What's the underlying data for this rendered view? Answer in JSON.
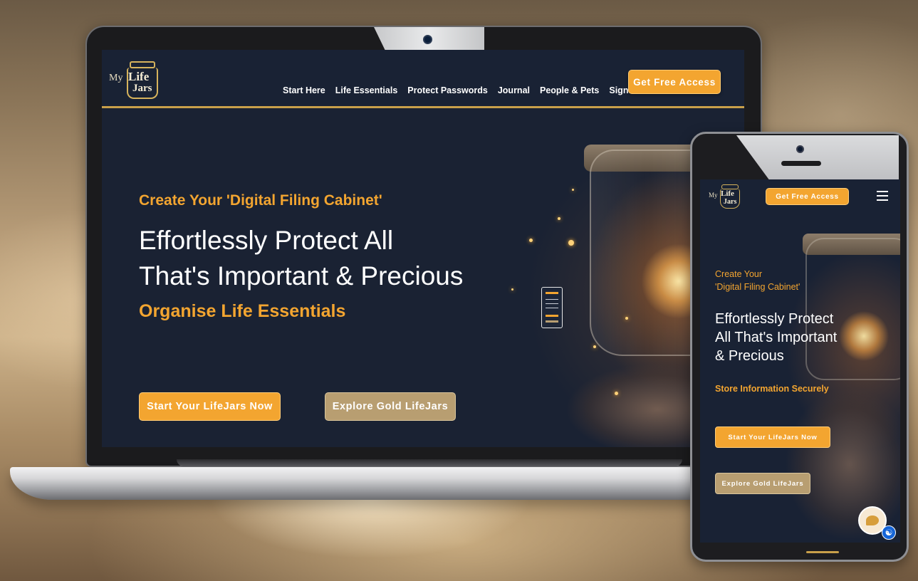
{
  "brand": {
    "logo_my": "My",
    "logo_life": "Life",
    "logo_jars": "Jars",
    "accent_color": "#f3a530",
    "gold_color": "#b89e71",
    "background_color": "#192234"
  },
  "laptop": {
    "nav": {
      "items": [
        {
          "label": "Start Here"
        },
        {
          "label": "Life Essentials"
        },
        {
          "label": "Protect Passwords"
        },
        {
          "label": "Journal"
        },
        {
          "label": "People & Pets"
        },
        {
          "label": "Sign In"
        }
      ],
      "cta_label": "Get Free Access"
    },
    "hero": {
      "eyebrow": "Create Your 'Digital Filing Cabinet'",
      "title_line1": "Effortlessly Protect All",
      "title_line2": "That's Important & Precious",
      "subtitle": "Organise Life Essentials",
      "primary_button": "Start Your LifeJars Now",
      "secondary_button": "Explore Gold LifeJars"
    }
  },
  "phone": {
    "header": {
      "cta_label": "Get Free Access",
      "menu_icon": "hamburger-icon"
    },
    "hero": {
      "eyebrow_line1": "Create Your",
      "eyebrow_line2": "'Digital Filing Cabinet'",
      "title_line1": "Effortlessly Protect",
      "title_line2": "All That's Important",
      "title_line3": "& Precious",
      "subtitle": "Store Information Securely",
      "primary_button": "Start Your LifeJars Now",
      "secondary_button": "Explore Gold LifeJars"
    },
    "widgets": {
      "chat_icon": "chat-bubble-icon",
      "accessibility_icon": "accessibility-icon"
    }
  }
}
